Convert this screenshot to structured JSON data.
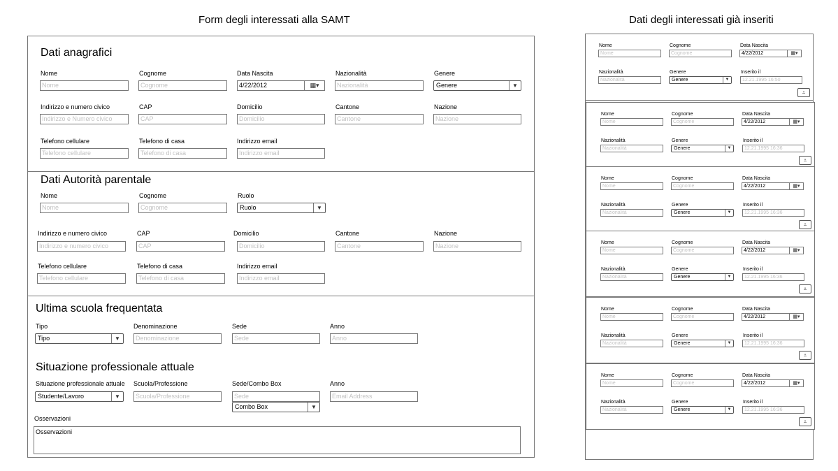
{
  "form": {
    "title": "Form degli interessati alla SAMT",
    "anagrafici": {
      "heading": "Dati anagrafici",
      "nome": {
        "label": "Nome",
        "placeholder": "Nome"
      },
      "cognome": {
        "label": "Cognome",
        "placeholder": "Cognome"
      },
      "data_nascita": {
        "label": "Data Nascita",
        "value": "4/22/2012"
      },
      "nazionalita": {
        "label": "Nazionalità",
        "placeholder": "Nazionalità"
      },
      "genere": {
        "label": "Genere",
        "value": "Genere"
      },
      "indirizzo": {
        "label": "Indirizzo e numero civico",
        "placeholder": "Indirizzo e Numero civico"
      },
      "cap": {
        "label": "CAP",
        "placeholder": "CAP"
      },
      "domicilio": {
        "label": "Domicilio",
        "placeholder": "Domicilio"
      },
      "cantone": {
        "label": "Cantone",
        "placeholder": "Cantone"
      },
      "nazione": {
        "label": "Nazione",
        "placeholder": "Nazione"
      },
      "tel_cell": {
        "label": "Telefono cellulare",
        "placeholder": "Telefono cellulare"
      },
      "tel_casa": {
        "label": "Telefono di casa",
        "placeholder": "Telefono di casa"
      },
      "email": {
        "label": "Indirizzo email",
        "placeholder": "Indirizzo email"
      }
    },
    "parentale": {
      "heading": "Dati Autorità parentale",
      "nome": {
        "label": "Nome",
        "placeholder": "Nome"
      },
      "cognome": {
        "label": "Cognome",
        "placeholder": "Cognome"
      },
      "ruolo": {
        "label": "Ruolo",
        "value": "Ruolo"
      },
      "indirizzo": {
        "label": "Indirizzo e numero civico",
        "placeholder": "Indirizzo e numero civico"
      },
      "cap": {
        "label": "CAP",
        "placeholder": "CAP"
      },
      "domicilio": {
        "label": "Domicilio",
        "placeholder": "Domicilio"
      },
      "cantone": {
        "label": "Cantone",
        "placeholder": "Cantone"
      },
      "nazione": {
        "label": "Nazione",
        "placeholder": "Nazione"
      },
      "tel_cell": {
        "label": "Telefono cellulare",
        "placeholder": "Telefono cellulare"
      },
      "tel_casa": {
        "label": "Telefono di casa",
        "placeholder": "Telefono di casa"
      },
      "email": {
        "label": "Indirizzo email",
        "placeholder": "Indirizzo email"
      }
    },
    "scuola": {
      "heading": "Ultima scuola frequentata",
      "tipo": {
        "label": "Tipo",
        "value": "Tipo"
      },
      "denominazione": {
        "label": "Denominazione",
        "placeholder": "Denominazione"
      },
      "sede": {
        "label": "Sede",
        "placeholder": "Sede"
      },
      "anno": {
        "label": "Anno",
        "placeholder": "Anno"
      }
    },
    "professione": {
      "heading": "Situazione professionale attuale",
      "situazione": {
        "label": "Situazione professionale attuale",
        "value": "Studente/Lavoro"
      },
      "scuola_prof": {
        "label": "Scuola/Professione",
        "placeholder": "Scuola/Professione"
      },
      "sede": {
        "label": "Sede/Combo Box",
        "placeholder": "Sede",
        "combo": "Combo Box"
      },
      "anno": {
        "label": "Anno",
        "placeholder": "Email Address"
      }
    },
    "osservazioni": {
      "label": "Osservazioni",
      "value": "Osservazioni"
    }
  },
  "list": {
    "title": "Dati degli interessati già inseriti",
    "labels": {
      "nome": "Nome",
      "cognome": "Cognome",
      "data_nascita": "Data Nascita",
      "nazionalita": "Nazionalità",
      "genere": "Genere",
      "inserito": "Inserito il"
    },
    "cards": [
      {
        "nome": "Nome",
        "cognome": "Cognome",
        "data": "4/22/2012",
        "nazionalita": "Nazionalità",
        "genere": "Genere",
        "inserito": "12.21.1995 16:50"
      },
      {
        "nome": "Nome",
        "cognome": "Cognome",
        "data": "4/22/2012",
        "nazionalita": "Nazionalità",
        "genere": "Genere",
        "inserito": "12.21.1995 16:36"
      },
      {
        "nome": "Nome",
        "cognome": "Cognome",
        "data": "4/22/2012",
        "nazionalita": "Nazionalità",
        "genere": "Genere",
        "inserito": "12.21.1995 16:36"
      },
      {
        "nome": "Nome",
        "cognome": "Cognome",
        "data": "4/22/2012",
        "nazionalita": "Nazionalità",
        "genere": "Genere",
        "inserito": "12.21.1995 16:36"
      },
      {
        "nome": "Nome",
        "cognome": "Cognome",
        "data": "4/22/2012",
        "nazionalita": "Nazionalità",
        "genere": "Genere",
        "inserito": "12.21.1995 16:36"
      },
      {
        "nome": "Nome",
        "cognome": "Cognome",
        "data": "4/22/2012",
        "nazionalita": "Nazionalità",
        "genere": "Genere",
        "inserito": "12.21.1995 16:36"
      }
    ]
  },
  "icons": {
    "calendar": "calendar-icon",
    "dropdown": "chevron-down-icon",
    "expand": "expand-icon"
  }
}
